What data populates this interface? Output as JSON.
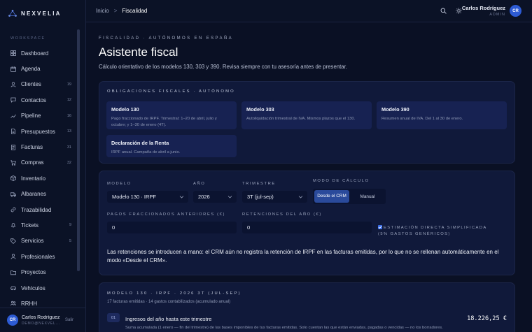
{
  "brand": {
    "name": "NEXVELIA"
  },
  "sidebar": {
    "section_label": "WORKSPACE",
    "items": [
      {
        "label": "Dashboard",
        "icon": "grid-icon",
        "badge": ""
      },
      {
        "label": "Agenda",
        "icon": "calendar-icon",
        "badge": ""
      },
      {
        "label": "Clientes",
        "icon": "user-icon",
        "badge": "19"
      },
      {
        "label": "Contactos",
        "icon": "chat-icon",
        "badge": "12"
      },
      {
        "label": "Pipeline",
        "icon": "chart-icon",
        "badge": "16"
      },
      {
        "label": "Presupuestos",
        "icon": "document-icon",
        "badge": "13"
      },
      {
        "label": "Facturas",
        "icon": "invoice-icon",
        "badge": "31"
      },
      {
        "label": "Compras",
        "icon": "cart-icon",
        "badge": "32"
      },
      {
        "label": "Inventario",
        "icon": "box-icon",
        "badge": ""
      },
      {
        "label": "Albaranes",
        "icon": "truck-icon",
        "badge": ""
      },
      {
        "label": "Trazabilidad",
        "icon": "link-icon",
        "badge": ""
      },
      {
        "label": "Tickets",
        "icon": "bell-icon",
        "badge": "9"
      },
      {
        "label": "Servicios",
        "icon": "tag-icon",
        "badge": "5"
      },
      {
        "label": "Profesionales",
        "icon": "person-icon",
        "badge": ""
      },
      {
        "label": "Proyectos",
        "icon": "folder-icon",
        "badge": ""
      },
      {
        "label": "Vehículos",
        "icon": "car-icon",
        "badge": ""
      },
      {
        "label": "RRHH",
        "icon": "people-icon",
        "badge": ""
      }
    ],
    "user": {
      "initials": "CR",
      "name": "Carlos Rodríguez",
      "email": "DEMO@NEXVEL...",
      "logout_label": "Salir"
    }
  },
  "topbar": {
    "breadcrumb": {
      "home": "Inicio",
      "separator": ">",
      "current": "Fiscalidad"
    },
    "user": {
      "name": "Carlos Rodríguez",
      "role": "ADMIN",
      "initials": "CR"
    }
  },
  "page": {
    "eyebrow": "FISCALIDAD · AUTÓNOMOS EN ESPAÑA",
    "title": "Asistente fiscal",
    "description": "Cálculo orientativo de los modelos 130, 303 y 390. Revisa siempre con tu asesoría antes de presentar."
  },
  "obligations": {
    "eyebrow": "OBLIGACIONES FISCALES · AUTÓNOMO",
    "items": [
      {
        "title": "Modelo 130",
        "desc": "Pago fraccionado de IRPF. Trimestral: 1–20 de abril, julio y octubre; y 1–30 de enero (4T)."
      },
      {
        "title": "Modelo 303",
        "desc": "Autoliquidación trimestral de IVA. Mismos plazos que el 130."
      },
      {
        "title": "Modelo 390",
        "desc": "Resumen anual de IVA. Del 1 al 30 de enero."
      },
      {
        "title": "Declaración de la Renta",
        "desc": "IRPF anual. Campaña de abril a junio."
      }
    ]
  },
  "form": {
    "modelo_label": "MODELO",
    "modelo_value": "Modelo 130 · IRPF",
    "anio_label": "AÑO",
    "anio_value": "2026",
    "trimestre_label": "TRIMESTRE",
    "trimestre_value": "3T (jul-sep)",
    "modo_label": "MODO DE CÁLCULO",
    "modo_crm": "Desde el CRM",
    "modo_manual": "Manual",
    "pagos_label": "PAGOS FRACCIONADOS ANTERIORES (€)",
    "pagos_value": "0",
    "retenciones_label": "RETENCIONES DEL AÑO (€)",
    "retenciones_value": "0",
    "estimacion_label": "ESTIMACIÓN DIRECTA SIMPLIFICADA (5% GASTOS GENÉRICOS)",
    "estimacion_checked": true,
    "note": "Las retenciones se introducen a mano: el CRM aún no registra la retención de IRPF en las facturas emitidas, por lo que no se rellenan automáticamente en el modo «Desde el CRM»."
  },
  "summary": {
    "eyebrow": "MODELO 130 · IRPF · 2026 3T (JUL-SEP)",
    "subtitle": "17 facturas emitidas · 14 gastos contabilizados (acumulado anual)",
    "row": {
      "badge": "01",
      "title": "Ingresos del año hasta este trimestre",
      "amount": "18.226,25 €",
      "desc": "Suma acumulada (1 enero — fin del trimestre) de las bases imponibles de tus facturas emitidas. Solo cuentan las que están enviadas, pagadas o vencidas — no los borradores."
    }
  }
}
